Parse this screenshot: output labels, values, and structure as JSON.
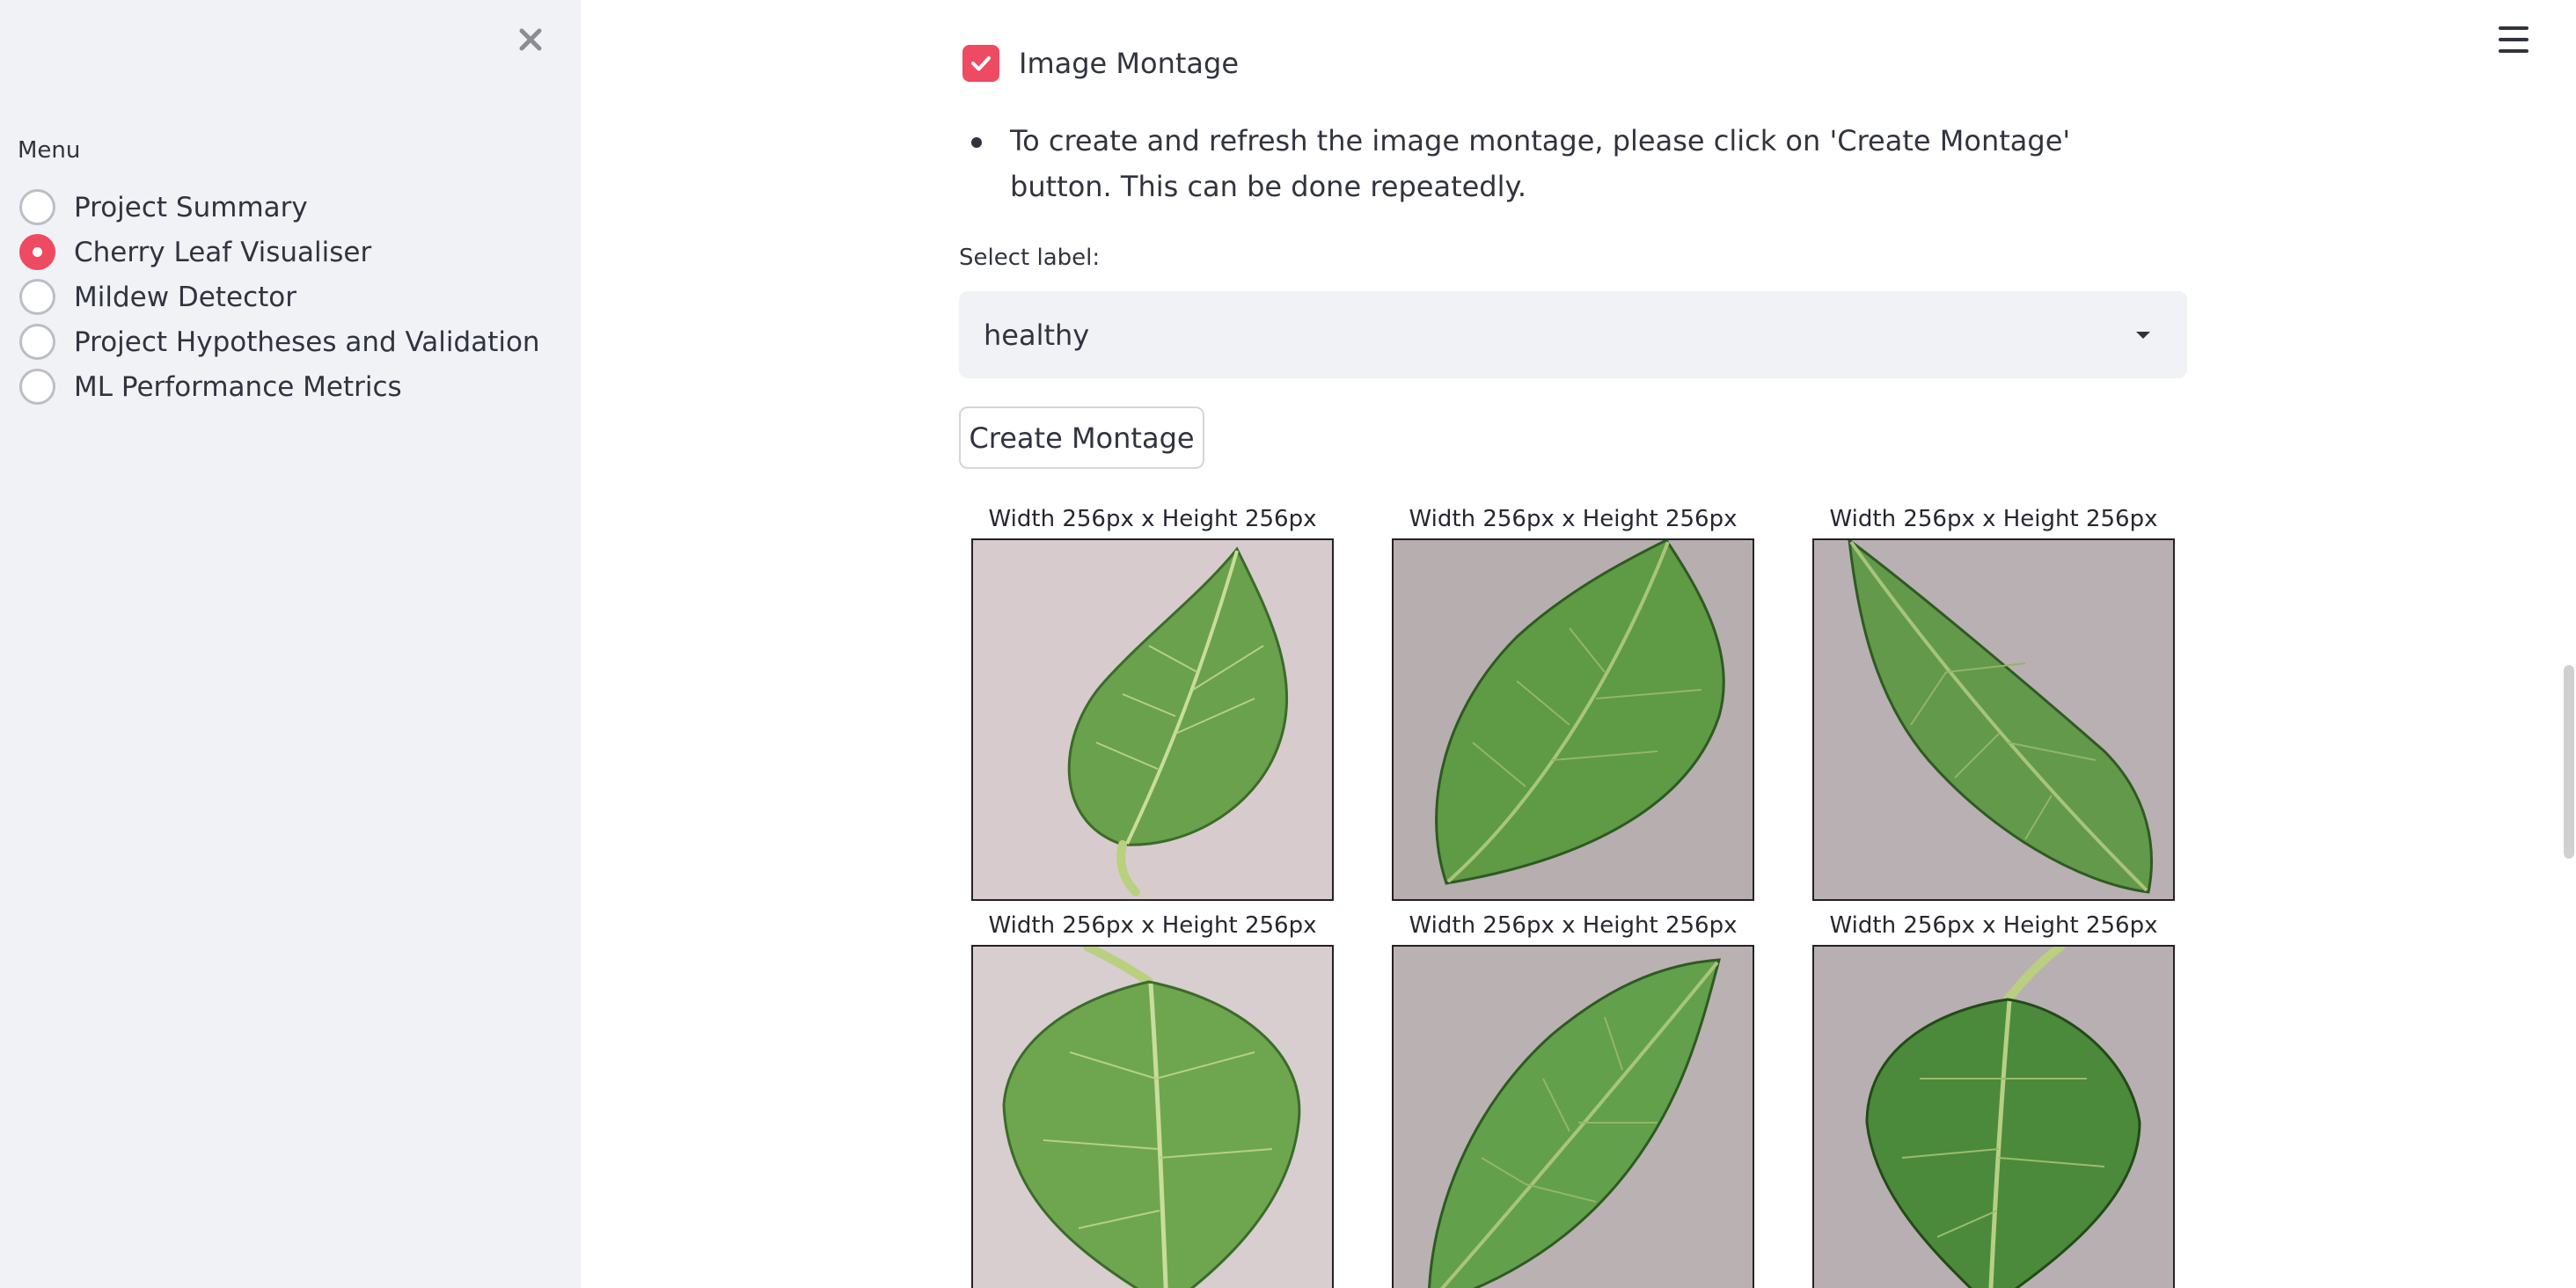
{
  "sidebar": {
    "menu_title": "Menu",
    "items": [
      {
        "label": "Project Summary",
        "selected": false
      },
      {
        "label": "Cherry Leaf Visualiser",
        "selected": true
      },
      {
        "label": "Mildew Detector",
        "selected": false
      },
      {
        "label": "Project Hypotheses and Validation",
        "selected": false
      },
      {
        "label": "ML Performance Metrics",
        "selected": false
      }
    ],
    "close_icon": "close-icon"
  },
  "header": {
    "menu_icon": "hamburger-icon"
  },
  "main": {
    "montage_checkbox": {
      "label": "Image Montage",
      "checked": true
    },
    "instruction": "To create and refresh the image montage, please click on 'Create Montage' button. This can be done repeatedly.",
    "select": {
      "label": "Select label:",
      "value": "healthy"
    },
    "create_button": "Create Montage",
    "montage": {
      "captions": [
        "Width 256px x Height 256px",
        "Width 256px x Height 256px",
        "Width 256px x Height 256px",
        "Width 256px x Height 256px",
        "Width 256px x Height 256px",
        "Width 256px x Height 256px"
      ]
    }
  },
  "colors": {
    "accent": "#ee4a62",
    "sidebar_bg": "#f0f2f6",
    "text": "#31333f",
    "leaf": "#5f9a45",
    "leaf_vein": "#c9dd9a",
    "photo_bg_light": "#d8cbcd",
    "photo_bg_gray": "#b7aeb0"
  }
}
